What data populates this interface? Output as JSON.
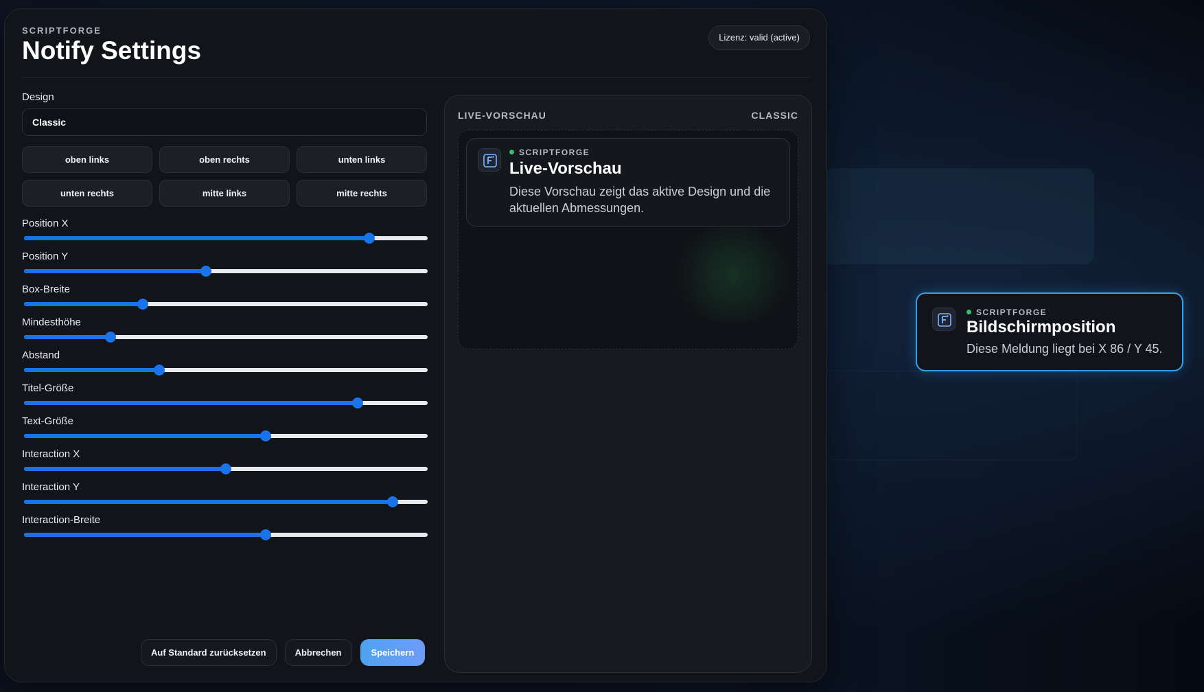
{
  "app": {
    "brand": "SCRIPTFORGE",
    "title": "Notify Settings",
    "license": "Lizenz: valid (active)"
  },
  "design": {
    "label": "Design",
    "value": "Classic"
  },
  "positions": [
    "oben links",
    "oben rechts",
    "unten links",
    "unten rechts",
    "mitte links",
    "mitte rechts"
  ],
  "sliders": [
    {
      "label": "Position X",
      "value": 0.855
    },
    {
      "label": "Position Y",
      "value": 0.45
    },
    {
      "label": "Box-Breite",
      "value": 0.295
    },
    {
      "label": "Mindesthöhe",
      "value": 0.215
    },
    {
      "label": "Abstand",
      "value": 0.335
    },
    {
      "label": "Titel-Größe",
      "value": 0.827
    },
    {
      "label": "Text-Größe",
      "value": 0.598
    },
    {
      "label": "Interaction X",
      "value": 0.5
    },
    {
      "label": "Interaction Y",
      "value": 0.914
    },
    {
      "label": "Interaction-Breite",
      "value": 0.598
    }
  ],
  "actions": {
    "reset": "Auf Standard zurücksetzen",
    "cancel": "Abbrechen",
    "save": "Speichern"
  },
  "preview": {
    "label": "LIVE-VORSCHAU",
    "design": "CLASSIC",
    "notification": {
      "brand": "SCRIPTFORGE",
      "title": "Live-Vorschau",
      "text": "Diese Vorschau zeigt das aktive Design und die aktuellen Abmessungen."
    }
  },
  "screen_notification": {
    "brand": "SCRIPTFORGE",
    "title": "Bildschirmposition",
    "text": "Diese Meldung liegt bei X 86 / Y 45."
  },
  "colors": {
    "accent": "#1a73e8",
    "status_dot": "#36c06b",
    "highlight_border": "#3aa0e6"
  },
  "icons": {
    "notification": "scriptforge-logo-icon"
  }
}
